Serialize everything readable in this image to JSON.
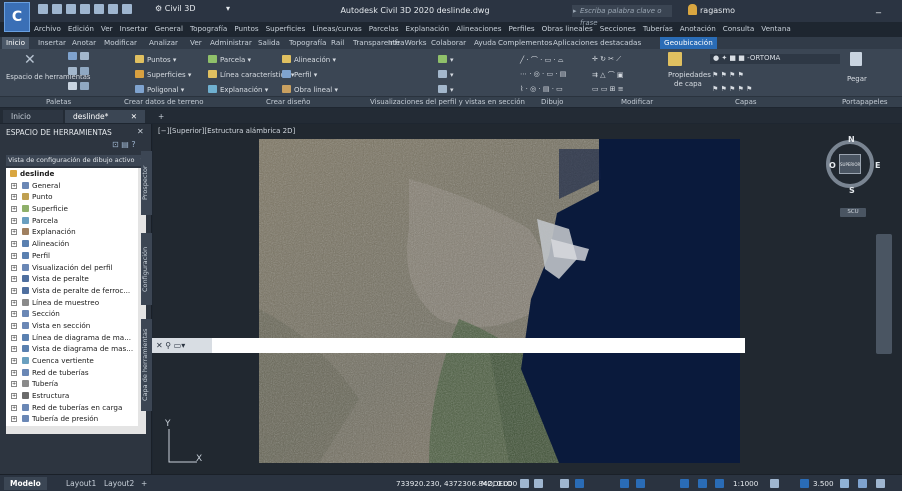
{
  "app": {
    "workspace": "Civil 3D",
    "title": "Autodesk Civil 3D 2020   deslinde.dwg",
    "search_placeholder": "Escriba palabra clave o frase",
    "user": "ragasmo"
  },
  "menu": [
    "Archivo",
    "Edición",
    "Ver",
    "Insertar",
    "General",
    "Topografía",
    "Puntos",
    "Superficies",
    "Líneas/curvas",
    "Parcelas",
    "Explanación",
    "Alineaciones",
    "Perfiles",
    "Obras lineales",
    "Secciones",
    "Tuberías",
    "Anotación",
    "Consulta",
    "Ventana"
  ],
  "ribbon_tabs": [
    "Inicio",
    "Insertar",
    "Anotar",
    "Modificar",
    "Analizar",
    "Ver",
    "Administrar",
    "Salida",
    "Topografía",
    "Rail",
    "Transparente",
    "InfraWorks",
    "Colaborar",
    "Ayuda",
    "Complementos",
    "Aplicaciones destacadas",
    "Geoubicación"
  ],
  "ribbon": {
    "toolspace_btn": "Espacio de herramientas",
    "puntos": "Puntos",
    "superficies": "Superficies",
    "poligonal": "Poligonal",
    "parcela": "Parcela",
    "linea_caracteristica": "Línea característica",
    "explanacion": "Explanación",
    "alineacion": "Alineación",
    "perfil": "Perfil",
    "obra_lineal": "Obra lineal",
    "layer_name": "ORTOMA",
    "propiedades": "Propiedades",
    "de_capa": "de capa",
    "pegar": "Pegar",
    "panel_labels": [
      "Paletas",
      "Crear datos de terreno",
      "Crear diseño",
      "Visualizaciones del perfil y vistas en sección",
      "Dibujo",
      "Modificar",
      "Capas",
      "Portapapeles"
    ]
  },
  "doc_tabs": [
    "Inicio",
    "deslinde*"
  ],
  "toolspace": {
    "title": "ESPACIO DE HERRAMIENTAS",
    "view_select": "Vista de configuración de dibujo activo",
    "root": "deslinde",
    "items": [
      "General",
      "Punto",
      "Superficie",
      "Parcela",
      "Explanación",
      "Alineación",
      "Perfil",
      "Visualización del perfil",
      "Vista de peralte",
      "Vista de peralte de ferroc...",
      "Línea de muestreo",
      "Sección",
      "Vista en sección",
      "Línea de diagrama de ma...",
      "Vista de diagrama de mas...",
      "Cuenca vertiente",
      "Red de tuberías",
      "Tubería",
      "Estructura",
      "Red de tuberías en carga",
      "Tubería de presión"
    ],
    "side_tabs": [
      "Prospector",
      "Configuración",
      "Capa de herramientas"
    ]
  },
  "drawing": {
    "view_label": "[−][Superior][Estructura alámbrica 2D]",
    "ucs_x": "X",
    "ucs_y": "Y"
  },
  "viewcube": {
    "n": "N",
    "s": "S",
    "e": "E",
    "w": "O",
    "face": "SUPERIOR",
    "wcs": "SCU"
  },
  "statusbar": {
    "layout_tabs": [
      "Modelo",
      "Layout1",
      "Layout2"
    ],
    "coords": "733920.230, 4372306.842, 0.000",
    "space": "MODELO",
    "scale": "1:1000",
    "num": "3.500"
  },
  "colors": {
    "accent": "#2a6cb6",
    "ribbon_bg": "#3b4654",
    "sea": "#0a1a3c"
  }
}
